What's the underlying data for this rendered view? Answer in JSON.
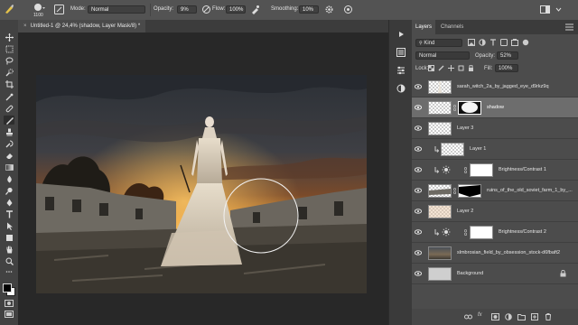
{
  "options_bar": {
    "brush_size": "1100",
    "mode_label": "Mode:",
    "mode_value": "Normal",
    "opacity_label": "Opacity:",
    "opacity_value": "9%",
    "flow_label": "Flow:",
    "flow_value": "100%",
    "smoothing_label": "Smoothing:",
    "smoothing_value": "10%"
  },
  "document": {
    "tab_title": "Untitled-1 @ 24,4% (shadow, Layer Mask/8) *"
  },
  "tools": [
    "move-icon",
    "marquee-icon",
    "lasso-icon",
    "quick-select-icon",
    "crop-icon",
    "eyedropper-icon",
    "healing-icon",
    "brush-icon",
    "stamp-icon",
    "history-brush-icon",
    "eraser-icon",
    "gradient-icon",
    "blur-icon",
    "dodge-icon",
    "pen-icon",
    "type-icon",
    "path-select-icon",
    "shape-icon",
    "hand-icon",
    "zoom-icon"
  ],
  "layers_panel": {
    "tabs": [
      "Layers",
      "Channels"
    ],
    "filter_label": "Kind",
    "blend_mode": "Normal",
    "opacity_label": "Opacity:",
    "opacity_value": "52%",
    "lock_label": "Lock:",
    "fill_label": "Fill:",
    "fill_value": "100%",
    "layers": [
      {
        "name": "sarah_witch_2a_by_jagged_eye_d9rkz9q",
        "selected": false
      },
      {
        "name": "shadow",
        "selected": true
      },
      {
        "name": "Layer 3",
        "selected": false
      },
      {
        "name": "Layer 1",
        "selected": false
      },
      {
        "name": "Brightness/Contrast 1",
        "selected": false
      },
      {
        "name": "ruins_of_the_old_soviet_farm_1_by_...",
        "selected": false
      },
      {
        "name": "Layer 2",
        "selected": false
      },
      {
        "name": "Brightness/Contrast 2",
        "selected": false
      },
      {
        "name": "slmbrosian_field_by_obsession_stock-d6fbaft2",
        "selected": false
      },
      {
        "name": "Background",
        "selected": false
      }
    ]
  },
  "colors": {
    "foreground": "#000000",
    "background": "#ffffff",
    "selected_row": "#6d6d6d",
    "panel_bg": "#4c4c4c"
  }
}
